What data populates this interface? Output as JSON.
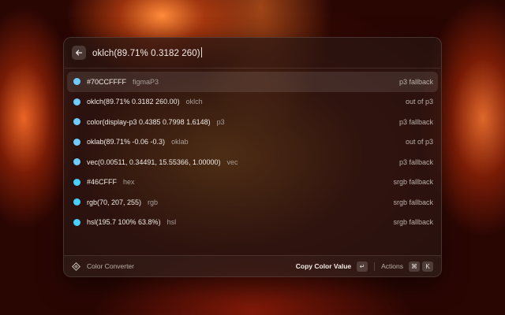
{
  "search": {
    "query": "oklch(89.71% 0.3182 260)"
  },
  "results": [
    {
      "value": "#70CCFFFF",
      "kind": "figmaP3",
      "accessory": "p3 fallback",
      "swatch": "#70ccff",
      "selected": true
    },
    {
      "value": "oklch(89.71% 0.3182 260.00)",
      "kind": "oklch",
      "accessory": "out of p3",
      "swatch": "#70ccff",
      "selected": false
    },
    {
      "value": "color(display-p3 0.4385 0.7998 1.6148)",
      "kind": "p3",
      "accessory": "p3 fallback",
      "swatch": "#70ccff",
      "selected": false
    },
    {
      "value": "oklab(89.71% -0.06 -0.3)",
      "kind": "oklab",
      "accessory": "out of p3",
      "swatch": "#70ccff",
      "selected": false
    },
    {
      "value": "vec(0.00511, 0.34491, 15.55366, 1.00000)",
      "kind": "vec",
      "accessory": "p3 fallback",
      "swatch": "#70ccff",
      "selected": false
    },
    {
      "value": "#46CFFF",
      "kind": "hex",
      "accessory": "srgb fallback",
      "swatch": "#46cfff",
      "selected": false
    },
    {
      "value": "rgb(70, 207, 255)",
      "kind": "rgb",
      "accessory": "srgb fallback",
      "swatch": "#46cfff",
      "selected": false
    },
    {
      "value": "hsl(195.7 100% 63.8%)",
      "kind": "hsl",
      "accessory": "srgb fallback",
      "swatch": "#46cfff",
      "selected": false
    }
  ],
  "footer": {
    "extension_name": "Color Converter",
    "primary_action": "Copy Color Value",
    "enter_key": "↵",
    "actions_label": "Actions",
    "cmd_key": "⌘",
    "k_key": "K"
  }
}
